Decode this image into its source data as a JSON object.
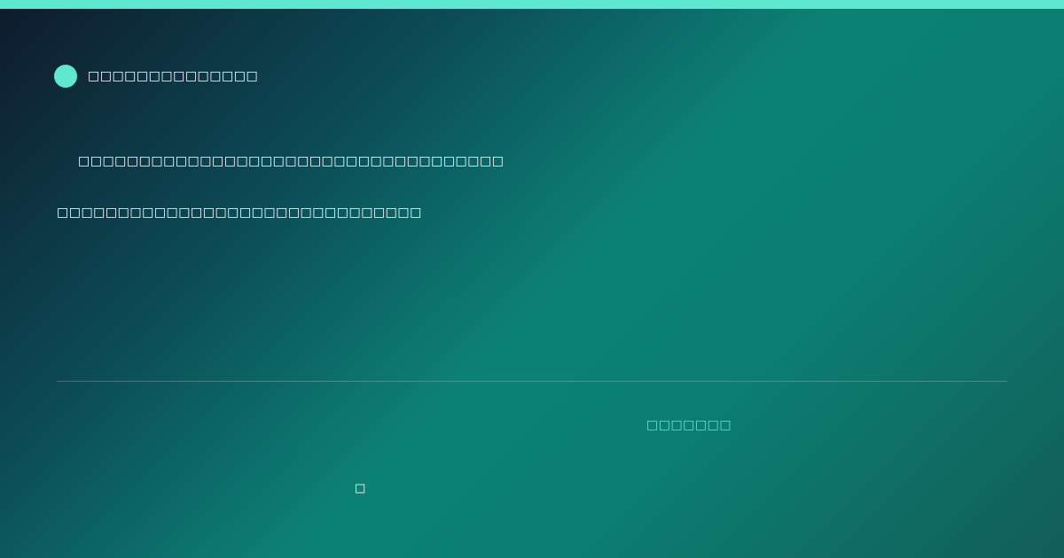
{
  "colors": {
    "accent": "#5ee8d2",
    "background_start": "#0f1a2c",
    "background_mid": "#0d8176",
    "background_end": "#125e58",
    "text": "#ffffff"
  },
  "brand": {
    "icon": "circle-dot-icon",
    "name": "□□□□□□□□□□□□□□"
  },
  "main": {
    "headline_line_1": "□□□□□□□□□□□□□□□□□□□□□□□□□□□□□□□□□□□",
    "headline_line_2": "□□□□□□□□□□□□□□□□□□□□□□□□□□□□□□"
  },
  "footer": {
    "link_label": "□□□□□□□",
    "mark": "□"
  }
}
